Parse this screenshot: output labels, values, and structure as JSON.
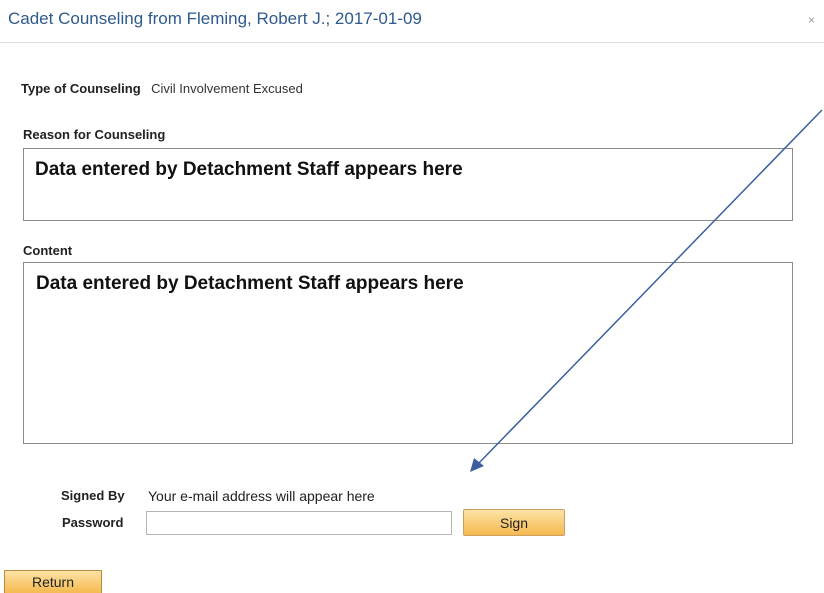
{
  "dialog": {
    "title": "Cadet Counseling from Fleming, Robert J.; 2017-01-09",
    "close_glyph": "×"
  },
  "form": {
    "type_label": "Type of Counseling",
    "type_value": "Civil Involvement Excused",
    "reason_label": "Reason for Counseling",
    "reason_value": "Data entered by Detachment Staff appears here",
    "content_label": "Content",
    "content_value": "Data entered by Detachment Staff appears here",
    "signed_by_label": "Signed By",
    "signed_by_value": "Your e-mail address will appear here",
    "password_label": "Password",
    "password_value": ""
  },
  "buttons": {
    "sign_label": "Sign",
    "return_label": "Return"
  },
  "annotation": {
    "arrow_color": "#3b5fa0",
    "arrow_icon": "arrow-pointer-icon"
  }
}
